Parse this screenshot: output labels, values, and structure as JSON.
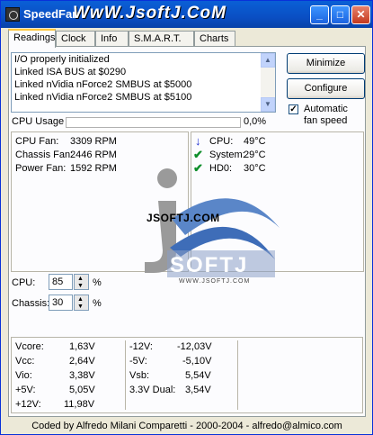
{
  "window": {
    "title": "SpeedFan",
    "watermark": "WwW.JsoftJ.CoM",
    "minimize_glyph": "_",
    "maximize_glyph": "□",
    "close_glyph": "✕"
  },
  "tabs": [
    "Readings",
    "Clock",
    "Info",
    "S.M.A.R.T.",
    "Charts"
  ],
  "log": {
    "lines": [
      "I/O properly initialized",
      "Linked ISA BUS at $0290",
      "Linked nVidia nForce2 SMBUS at $5000",
      "Linked nVidia nForce2 SMBUS at $5100"
    ]
  },
  "buttons": {
    "minimize": "Minimize",
    "configure": "Configure"
  },
  "auto_fan": {
    "label_1": "Automatic",
    "label_2": "fan speed",
    "checked": true,
    "check_glyph": "✓"
  },
  "cpu_usage": {
    "label": "CPU Usage",
    "value": "0,0%",
    "fraction": 0.0
  },
  "fans": [
    {
      "label": "CPU Fan:",
      "value": "3309 RPM"
    },
    {
      "label": "Chassis Fan:",
      "value": "2446 RPM"
    },
    {
      "label": "Power Fan:",
      "value": "1592 RPM"
    }
  ],
  "temps": [
    {
      "icon": "arrow-down-icon",
      "glyph": "↓",
      "label": "CPU:",
      "value": "49°C"
    },
    {
      "icon": "check-icon",
      "glyph": "✔",
      "label": "System:",
      "value": "29°C"
    },
    {
      "icon": "check-icon",
      "glyph": "✔",
      "label": "HD0:",
      "value": "30°C"
    }
  ],
  "watermark_logo": {
    "text_top": "JSOFTJ.COM",
    "text_main": "SOFTJ",
    "url": "WWW.JSOFTJ.COM"
  },
  "speeds": [
    {
      "label": "CPU:",
      "value": "85",
      "unit": "%"
    },
    {
      "label": "Chassis:",
      "value": "30",
      "unit": "%"
    }
  ],
  "voltages_left": [
    {
      "label": "Vcore:",
      "value": "1,63V"
    },
    {
      "label": "Vcc:",
      "value": "2,64V"
    },
    {
      "label": "Vio:",
      "value": "3,38V"
    },
    {
      "label": "+5V:",
      "value": "5,05V"
    },
    {
      "label": "+12V:",
      "value": "11,98V"
    }
  ],
  "voltages_right": [
    {
      "label": "-12V:",
      "value": "-12,03V"
    },
    {
      "label": "-5V:",
      "value": "-5,10V"
    },
    {
      "label": "Vsb:",
      "value": "5,54V"
    },
    {
      "label": "3.3V Dual:",
      "value": "3,54V"
    }
  ],
  "status": "Coded by Alfredo Milani Comparetti - 2000-2004 - alfredo@almico.com",
  "colors": {
    "titlebar": "#0A5FD6",
    "window_bg": "#ECE9D8",
    "tab_highlight": "#FFC83C"
  }
}
